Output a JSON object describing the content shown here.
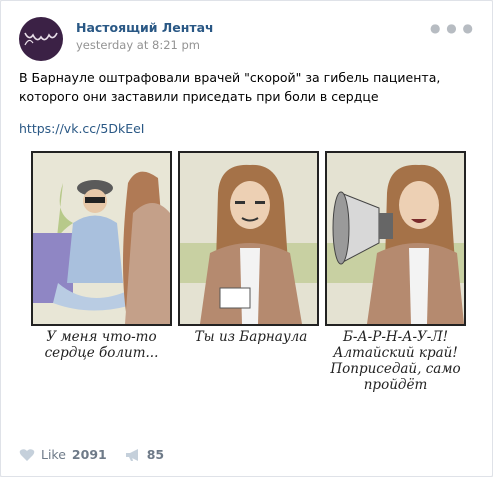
{
  "post": {
    "author": "Настоящий Лентач",
    "time": "yesterday at 8:21 pm",
    "text": "В Барнауле оштрафовали врачей \"скорой\" за гибель пациента, которого они заставили приседать при боли в сердце",
    "link": "https://vk.cc/5DkEeI"
  },
  "comic": {
    "captions": [
      "У меня что-то сердце болит...",
      "Ты из Барнаула",
      "Б-А-Р-Н-А-У-Л! Алтайский край! Поприседай, само пройдёт"
    ]
  },
  "footer": {
    "like_label": "Like",
    "like_count": "2091",
    "share_count": "85"
  }
}
